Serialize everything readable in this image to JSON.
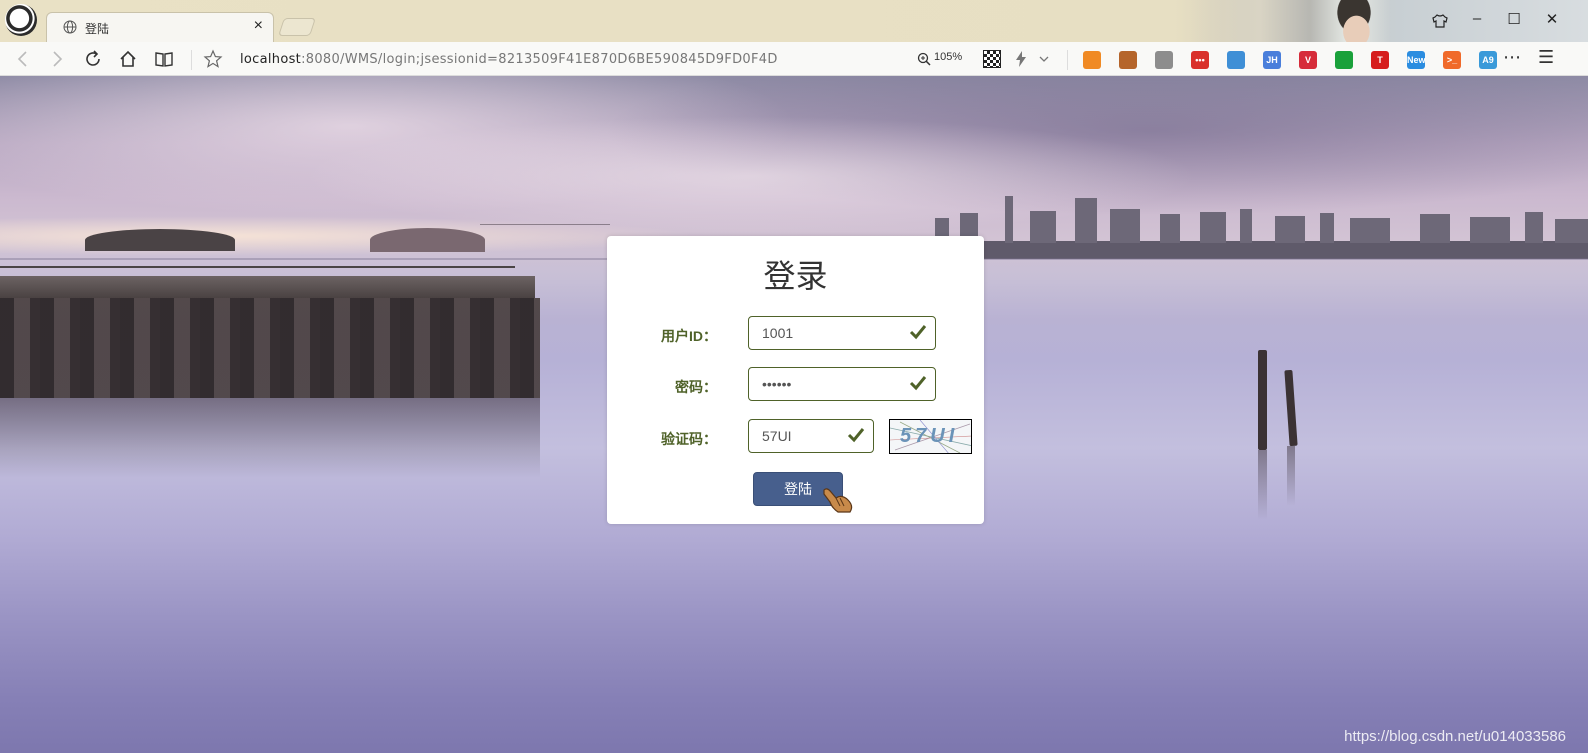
{
  "browser": {
    "tab_title": "登陆",
    "tab_close": "×",
    "url_host": "localhost",
    "url_rest": ":8080/WMS/login;jsessionid=8213509F41E870D6BE590845D9FD0F4D",
    "zoom": "105%",
    "window_controls": {
      "minimize": "–",
      "maximize": "☐",
      "close": "✕"
    },
    "menu_glyph": "⋯",
    "hamburger_glyph": "☰",
    "extensions": [
      {
        "name": "game-extension-icon",
        "color": "#f08a24",
        "label": ""
      },
      {
        "name": "monkey-extension-icon",
        "color": "#b5652b",
        "label": ""
      },
      {
        "name": "gear-extension-icon",
        "color": "#8d8d8d",
        "label": ""
      },
      {
        "name": "dots-extension-icon",
        "color": "#d9312b",
        "label": "•••"
      },
      {
        "name": "globe-extension-icon",
        "color": "#3f8fd6",
        "label": ""
      },
      {
        "name": "jh-extension-icon",
        "color": "#4a7fdb",
        "label": "JH"
      },
      {
        "name": "vivaldi-extension-icon",
        "color": "#d62c3a",
        "label": "V"
      },
      {
        "name": "green-square-extension-icon",
        "color": "#1aa13b",
        "label": ""
      },
      {
        "name": "t-extension-icon",
        "color": "#d61d1d",
        "label": "T"
      },
      {
        "name": "new-extension-icon",
        "color": "#2b8de0",
        "label": "New"
      },
      {
        "name": "terminal-extension-icon",
        "color": "#f06a2a",
        "label": ">_"
      },
      {
        "name": "shield-extension-icon",
        "color": "#3a9ad9",
        "label": "A9"
      }
    ]
  },
  "login": {
    "title": "登录",
    "user_id_label": "用户ID：",
    "user_id_value": "1001",
    "password_label": "密码：",
    "password_value": "••••••",
    "captcha_label": "验证码：",
    "captcha_value": "57UI",
    "captcha_image_text": "57UI",
    "submit_label": "登陆",
    "valid_color": "#4f6229"
  },
  "watermark": "https://blog.csdn.net/u014033586"
}
